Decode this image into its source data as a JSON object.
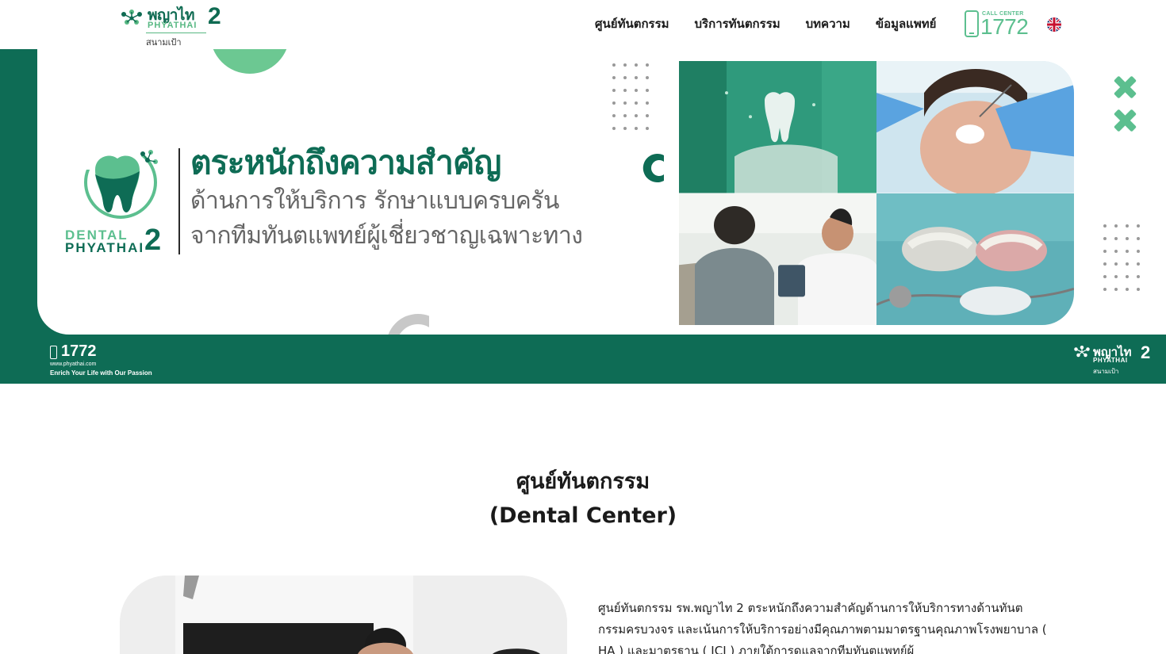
{
  "header": {
    "logo": {
      "name_th": "พญาไท",
      "name_en": "PHYATHAI",
      "number": "2",
      "branch": "สนามเป้า"
    },
    "nav": [
      "ศูนย์ทันตกรรม",
      "บริการทันตกรรม",
      "บทความ",
      "ข้อมูลแพทย์"
    ],
    "call_center": {
      "label": "CALL CENTER",
      "number": "1772"
    },
    "language_icon": "uk-flag-icon"
  },
  "banner": {
    "dental_logo": {
      "line1": "DENTAL",
      "line2": "PHYATHAI",
      "number": "2"
    },
    "headline": "ตระหนักถึงความสำคัญ",
    "subline1": "ด้านการให้บริการ รักษาแบบครบครัน",
    "subline2": "จากทีมทันตแพทย์ผู้เชี่ยวชาญเฉพาะทาง",
    "footer": {
      "number": "1772",
      "website": "www.phyathai.com",
      "slogan": "Enrich Your Life with Our Passion",
      "logo_th": "พญาไท",
      "logo_en": "PHYATHAI",
      "logo_num": "2",
      "logo_branch": "สนามเป้า"
    },
    "colors": {
      "dark_green": "#0e6c55",
      "light_green": "#5cbf8f"
    }
  },
  "section": {
    "title_th": "ศูนย์ทันตกรรม",
    "title_en": "(Dental Center)",
    "body": "ศูนย์ทันตกรรม รพ.พญาไท 2 ตระหนักถึงความสำคัญด้านการให้บริการทางด้านทันตกรรมครบวงจร และเน้นการให้บริการอย่างมีคุณภาพตามมาตรฐานคุณภาพโรงพยาบาล ( HA ) และมาตรฐาน ( JCI ) ภายใต้การดูแลจากทีมทันตแพทย์ผู้"
  }
}
